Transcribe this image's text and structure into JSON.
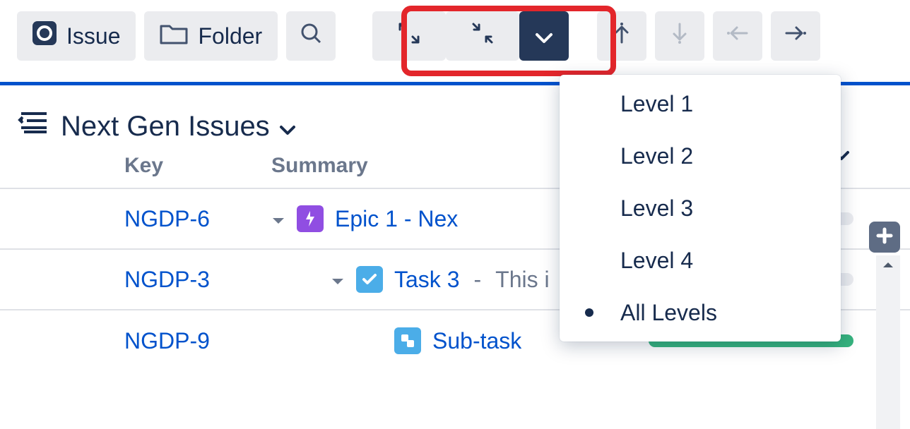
{
  "toolbar": {
    "issue_label": "Issue",
    "folder_label": "Folder"
  },
  "board": {
    "title": "Next Gen Issues"
  },
  "columns": {
    "key": "Key",
    "summary": "Summary"
  },
  "dropdown": {
    "items": [
      "Level 1",
      "Level 2",
      "Level 3",
      "Level 4",
      "All Levels"
    ],
    "selected_index": 4
  },
  "rows": [
    {
      "key": "NGDP-6",
      "summary": "Epic 1 - Nex",
      "type": "epic",
      "indent": 0,
      "toggle": true,
      "extra": ""
    },
    {
      "key": "NGDP-3",
      "summary": "Task 3",
      "type": "task",
      "indent": 1,
      "toggle": true,
      "extra": "This i"
    },
    {
      "key": "NGDP-9",
      "summary": "Sub-task",
      "type": "subtask",
      "indent": 2,
      "toggle": false,
      "extra": ""
    }
  ]
}
